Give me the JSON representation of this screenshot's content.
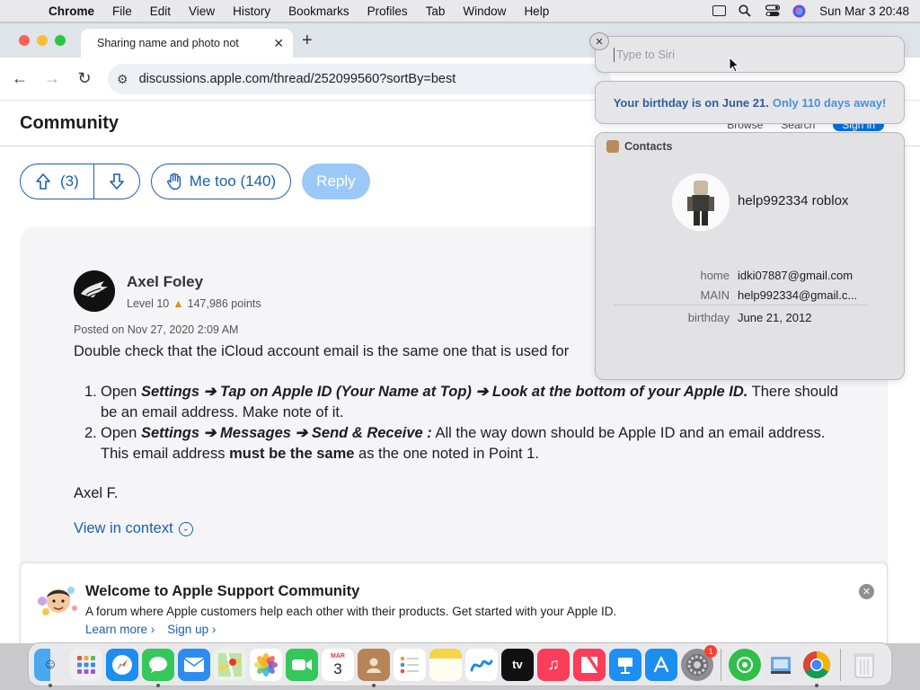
{
  "menubar": {
    "app": "Chrome",
    "items": [
      "File",
      "Edit",
      "View",
      "History",
      "Bookmarks",
      "Profiles",
      "Tab",
      "Window",
      "Help"
    ],
    "clock": "Sun Mar 3  20:48"
  },
  "browser": {
    "tab_title": "Sharing name and photo not",
    "url": "discussions.apple.com/thread/252099560?sortBy=best"
  },
  "page": {
    "section_title": "Community",
    "topnav": [
      "Browse",
      "Search",
      "Sign in"
    ],
    "upvote_count": "(3)",
    "metoo_label": "Me too (140)",
    "reply_label": "Reply",
    "post": {
      "author": "Axel Foley",
      "level": "Level 10",
      "points": "147,986 points",
      "posted": "Posted on Nov 27, 2020 2:09 AM",
      "intro": "Double check that the iCloud account email is the same one that is used for",
      "step1_open": "Open ",
      "step1_bold": "Settings ➔ Tap on Apple ID (Your Name at Top) ➔ Look at the bottom of your Apple ID.",
      "step1_rest": " There should be an email address. Make note of it.",
      "step2_open": "Open ",
      "step2_bold": "Settings ➔ Messages ➔ Send & Receive :",
      "step2_mid": " All the way down should be Apple ID and an email address. This email address ",
      "step2_bold2": "must be the same",
      "step2_end": " as the one noted in Point 1.",
      "signoff": "Axel F.",
      "view_context": "View in context"
    },
    "banner": {
      "title": "Welcome to Apple Support Community",
      "text": "A forum where Apple customers help each other with their products. Get started with your Apple ID.",
      "learn_more": "Learn more ›",
      "sign_up": "Sign up ›"
    }
  },
  "siri": {
    "placeholder": "Type to Siri",
    "birthday_main": "Your birthday is on June 21.",
    "birthday_days": "Only 110 days away!",
    "card_header": "Contacts",
    "contact_name": "help992334 roblox",
    "fields": [
      {
        "label": "home",
        "value": "idki07887@gmail.com"
      },
      {
        "label": "MAIN",
        "value": "help992334@gmail.c..."
      },
      {
        "label": "birthday",
        "value": "June 21, 2012"
      }
    ]
  },
  "dock": {
    "calendar_month": "MAR",
    "calendar_day": "3",
    "settings_badge": "1",
    "tv_label": "tv"
  },
  "colors": {
    "accent": "#1a5fb4",
    "reply_disabled": "#9cc8f7",
    "siri_date": "#2f5f9e",
    "siri_days": "#4a8fe0"
  }
}
